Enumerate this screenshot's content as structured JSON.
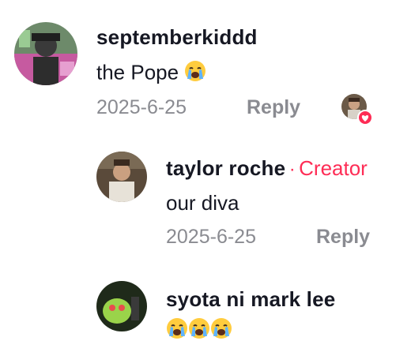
{
  "comments": [
    {
      "username": "septemberkiddd",
      "text": "the Pope",
      "date": "2025-6-25",
      "reply_label": "Reply"
    },
    {
      "username": "taylor roche",
      "separator": "·",
      "badge": "Creator",
      "text": "our diva",
      "date": "2025-6-25",
      "reply_label": "Reply"
    },
    {
      "username": "syota ni mark lee",
      "text": ""
    }
  ],
  "icons": {
    "emoji": "loudly-crying-face-emoji",
    "creator_like": "heart-icon"
  },
  "colors": {
    "accent": "#fe2c55",
    "meta_gray": "#8a8b91",
    "text": "#161823"
  }
}
